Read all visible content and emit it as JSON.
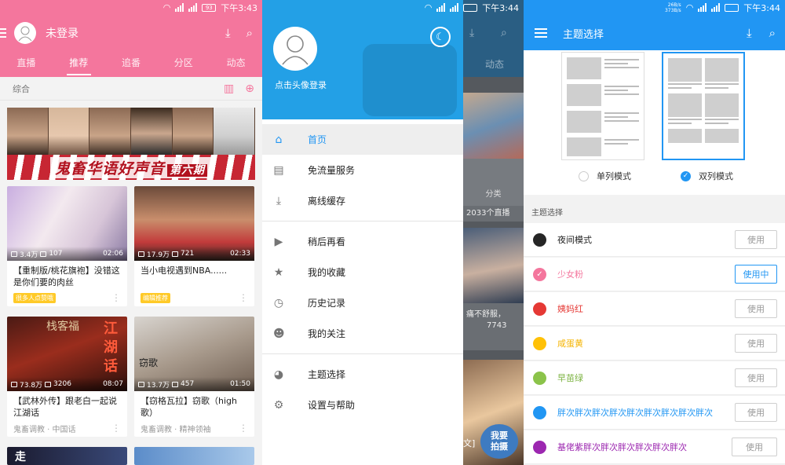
{
  "p1": {
    "status": {
      "time": "下午3:43",
      "battery": "93"
    },
    "title": "未登录",
    "tabs": [
      "直播",
      "推荐",
      "追番",
      "分区",
      "动态"
    ],
    "active_tab": 1,
    "sort_label": "综合",
    "banner": {
      "text": "鬼畜华语好声音",
      "tag": "第六期"
    },
    "cards": [
      {
        "views": "3.4万",
        "danmaku": "107",
        "duration": "02:06",
        "title": "【重制版/桃花旗袍】没错这是你们要的肉丝",
        "badge": "很多人点赞哦"
      },
      {
        "views": "17.9万",
        "danmaku": "721",
        "duration": "02:33",
        "title": "当小电视遇到NBA......",
        "badge": "编辑推荐"
      },
      {
        "views": "73.8万",
        "danmaku": "3206",
        "duration": "08:07",
        "title": "【武林外传】跟老白一起说江湖话",
        "foot": "鬼畜调教 · 中国话"
      },
      {
        "views": "13.7万",
        "danmaku": "457",
        "duration": "01:50",
        "title": "【窃格瓦拉】窃歌（high歌）",
        "foot": "鬼畜调教 · 精神领袖"
      }
    ],
    "thumb_texts": {
      "c3": "江湖话",
      "c3b": "栈客福",
      "c4": "窃歌",
      "bottom_left": "走"
    }
  },
  "p2": {
    "status": {
      "time": "下午3:44"
    },
    "login": "点击头像登录",
    "items": [
      {
        "icon": "home-icon",
        "label": "首页",
        "active": true
      },
      {
        "icon": "data-plan-icon",
        "label": "免流量服务"
      },
      {
        "icon": "download-icon",
        "label": "离线缓存"
      },
      {
        "icon": "watch-later-icon",
        "label": "稍后再看"
      },
      {
        "icon": "star-icon",
        "label": "我的收藏"
      },
      {
        "icon": "history-icon",
        "label": "历史记录"
      },
      {
        "icon": "people-icon",
        "label": "我的关注"
      },
      {
        "icon": "palette-icon",
        "label": "主题选择"
      },
      {
        "icon": "settings-icon",
        "label": "设置与帮助"
      }
    ],
    "bg": {
      "tab": "动态",
      "category": "分类",
      "live": "2033个直播",
      "snippet": "痛不舒服，",
      "views": "7743",
      "badge_line1": "我要",
      "badge_line2": "拍摄",
      "bottom_text": "文]"
    }
  },
  "p3": {
    "status": {
      "time": "下午3:44",
      "net_speed_top": "26B/s",
      "net_speed_bottom": "373B/s"
    },
    "title": "主题选择",
    "modes": [
      {
        "label": "单列模式",
        "selected": false
      },
      {
        "label": "双列模式",
        "selected": true
      }
    ],
    "section_label": "主题选择",
    "themes": [
      {
        "name": "夜间模式",
        "color": "#262626",
        "text_color": "#222222",
        "button": "使用"
      },
      {
        "name": "少女粉",
        "color": "#f4769d",
        "text_color": "#f4769d",
        "button": "使用中",
        "checked": true
      },
      {
        "name": "姨妈红",
        "color": "#e53935",
        "text_color": "#e53935",
        "button": "使用"
      },
      {
        "name": "咸蛋黄",
        "color": "#ffc107",
        "text_color": "#f5b400",
        "button": "使用"
      },
      {
        "name": "早苗绿",
        "color": "#8bc34a",
        "text_color": "#7cb342",
        "button": "使用"
      },
      {
        "name": "胖次胖次胖次胖次胖次胖次胖次胖次胖次",
        "color": "#2196f3",
        "text_color": "#2196f3",
        "button": "使用"
      },
      {
        "name": "基佬紫胖次胖次胖次胖次胖次胖次",
        "color": "#9c27b0",
        "text_color": "#9c27b0",
        "button": "使用"
      }
    ]
  }
}
